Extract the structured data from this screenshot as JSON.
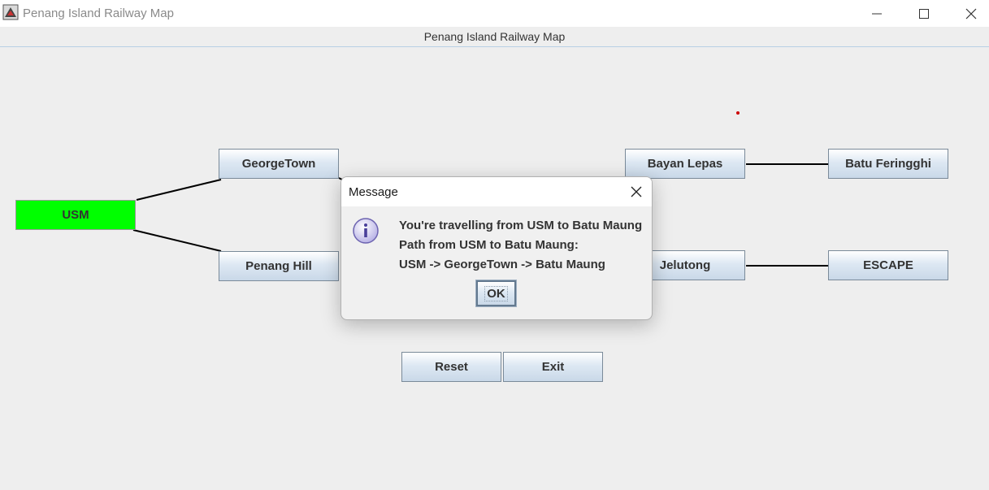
{
  "window": {
    "title": "Penang Island Railway Map",
    "minimize_icon": "minimize-icon",
    "maximize_icon": "maximize-icon",
    "close_icon": "close-icon"
  },
  "frame": {
    "header": "Penang Island Railway Map"
  },
  "stations": {
    "usm": "USM",
    "georgetown": "GeorgeTown",
    "penang_hill": "Penang Hill",
    "bayan_lepas": "Bayan Lepas",
    "batu_feringghi": "Batu Feringghi",
    "jelutong": "Jelutong",
    "escape": "ESCAPE"
  },
  "actions": {
    "reset": "Reset",
    "exit": "Exit"
  },
  "dialog": {
    "title": "Message",
    "icon": "info-icon",
    "line1": "You're travelling from USM to Batu Maung",
    "line2": "Path from USM to Batu Maung:",
    "line3": "USM -> GeorgeTown -> Batu Maung",
    "ok": "OK"
  },
  "colors": {
    "active_station": "#00ff00",
    "background": "#eeeeee",
    "marker": "#cc0000"
  }
}
